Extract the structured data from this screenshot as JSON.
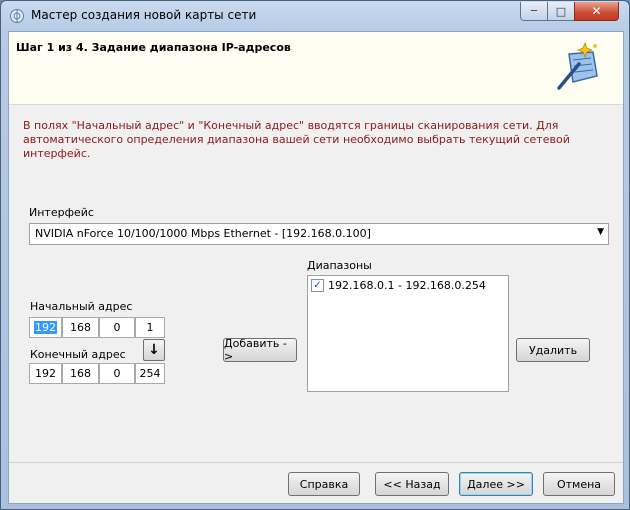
{
  "window": {
    "title": "Мастер создания новой карты сети",
    "min_glyph": "─",
    "max_glyph": "□",
    "close_glyph": "✕"
  },
  "header": {
    "step_title": "Шаг 1 из 4. Задание диапазона IP-адресов"
  },
  "description": "В полях \"Начальный адрес\" и \"Конечный адрес\" вводятся границы сканирования сети. Для автоматического определения диапазона вашей сети необходимо выбрать текущий сетевой интерфейс.",
  "interface": {
    "label": "Интерфейс",
    "selected": "NVIDIA nForce 10/100/1000 Mbps Ethernet - [192.168.0.100]",
    "arrow": "▼"
  },
  "start_address": {
    "label": "Начальный адрес",
    "octets": [
      "192",
      "168",
      "0",
      "1"
    ]
  },
  "end_address": {
    "label": "Конечный адрес",
    "octets": [
      "192",
      "168",
      "0",
      "254"
    ],
    "copy_glyph": "↓"
  },
  "buttons": {
    "add": "Добавить ->",
    "remove": "Удалить",
    "help": "Справка",
    "back": "<< Назад",
    "next": "Далее >>",
    "cancel": "Отмена"
  },
  "ranges": {
    "label": "Диапазоны",
    "items": [
      {
        "text": "192.168.0.1 - 192.168.0.254",
        "checked": "✓"
      }
    ]
  },
  "colors": {
    "description_text": "#8b1a1a",
    "header_band": "#fffef2",
    "selection": "#3399ff"
  }
}
